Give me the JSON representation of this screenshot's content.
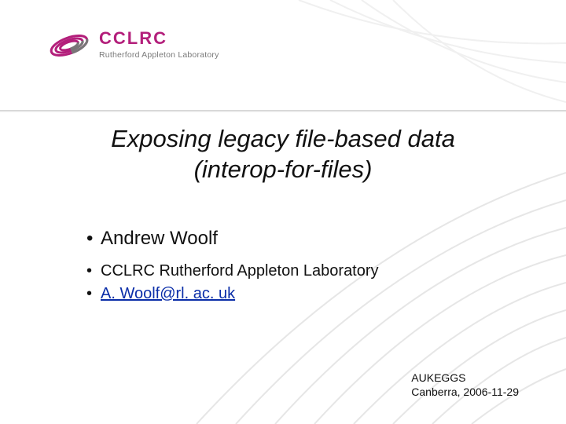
{
  "logo": {
    "name": "CCLRC",
    "sub": "Rutherford Appleton Laboratory"
  },
  "title": {
    "line1": "Exposing legacy file-based data",
    "line2": "(interop-for-files)"
  },
  "bullets": {
    "author": "Andrew Woolf",
    "affiliation": "CCLRC Rutherford Appleton Laboratory",
    "email": "A. Woolf@rl. ac. uk"
  },
  "footer": {
    "event": "AUKEGGS",
    "placeDate": "Canberra, 2006-11-29"
  }
}
